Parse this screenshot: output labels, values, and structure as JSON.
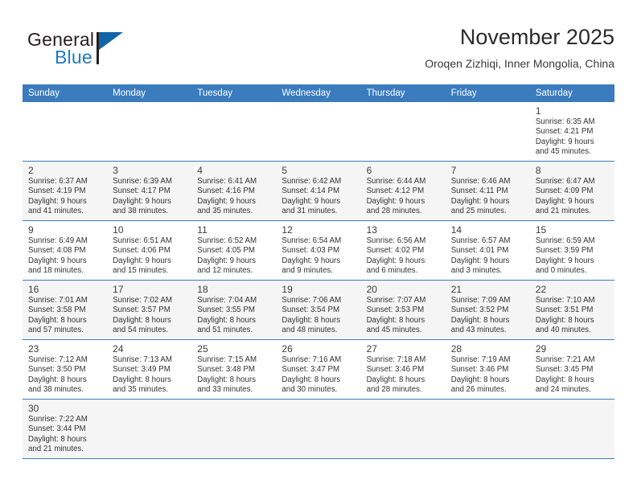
{
  "brand": {
    "name_part1": "General",
    "name_part2": "Blue",
    "logo_icon": "triangle-flag-icon",
    "accent_color": "#1164a8"
  },
  "header": {
    "title": "November 2025",
    "subtitle": "Oroqen Zizhiqi, Inner Mongolia, China"
  },
  "theme": {
    "header_bar_color": "#3a7cbe",
    "shaded_row_color": "#f5f5f5",
    "grid_line_color": "#3a7cbe"
  },
  "weekdays": [
    "Sunday",
    "Monday",
    "Tuesday",
    "Wednesday",
    "Thursday",
    "Friday",
    "Saturday"
  ],
  "weeks": [
    {
      "shaded": false,
      "days": [
        {
          "number": "",
          "sunrise": "",
          "sunset": "",
          "daylight_line1": "",
          "daylight_line2": "",
          "empty": true
        },
        {
          "number": "",
          "sunrise": "",
          "sunset": "",
          "daylight_line1": "",
          "daylight_line2": "",
          "empty": true
        },
        {
          "number": "",
          "sunrise": "",
          "sunset": "",
          "daylight_line1": "",
          "daylight_line2": "",
          "empty": true
        },
        {
          "number": "",
          "sunrise": "",
          "sunset": "",
          "daylight_line1": "",
          "daylight_line2": "",
          "empty": true
        },
        {
          "number": "",
          "sunrise": "",
          "sunset": "",
          "daylight_line1": "",
          "daylight_line2": "",
          "empty": true
        },
        {
          "number": "",
          "sunrise": "",
          "sunset": "",
          "daylight_line1": "",
          "daylight_line2": "",
          "empty": true
        },
        {
          "number": "1",
          "sunrise": "Sunrise: 6:35 AM",
          "sunset": "Sunset: 4:21 PM",
          "daylight_line1": "Daylight: 9 hours",
          "daylight_line2": "and 45 minutes.",
          "empty": false
        }
      ]
    },
    {
      "shaded": true,
      "days": [
        {
          "number": "2",
          "sunrise": "Sunrise: 6:37 AM",
          "sunset": "Sunset: 4:19 PM",
          "daylight_line1": "Daylight: 9 hours",
          "daylight_line2": "and 41 minutes.",
          "empty": false
        },
        {
          "number": "3",
          "sunrise": "Sunrise: 6:39 AM",
          "sunset": "Sunset: 4:17 PM",
          "daylight_line1": "Daylight: 9 hours",
          "daylight_line2": "and 38 minutes.",
          "empty": false
        },
        {
          "number": "4",
          "sunrise": "Sunrise: 6:41 AM",
          "sunset": "Sunset: 4:16 PM",
          "daylight_line1": "Daylight: 9 hours",
          "daylight_line2": "and 35 minutes.",
          "empty": false
        },
        {
          "number": "5",
          "sunrise": "Sunrise: 6:42 AM",
          "sunset": "Sunset: 4:14 PM",
          "daylight_line1": "Daylight: 9 hours",
          "daylight_line2": "and 31 minutes.",
          "empty": false
        },
        {
          "number": "6",
          "sunrise": "Sunrise: 6:44 AM",
          "sunset": "Sunset: 4:12 PM",
          "daylight_line1": "Daylight: 9 hours",
          "daylight_line2": "and 28 minutes.",
          "empty": false
        },
        {
          "number": "7",
          "sunrise": "Sunrise: 6:46 AM",
          "sunset": "Sunset: 4:11 PM",
          "daylight_line1": "Daylight: 9 hours",
          "daylight_line2": "and 25 minutes.",
          "empty": false
        },
        {
          "number": "8",
          "sunrise": "Sunrise: 6:47 AM",
          "sunset": "Sunset: 4:09 PM",
          "daylight_line1": "Daylight: 9 hours",
          "daylight_line2": "and 21 minutes.",
          "empty": false
        }
      ]
    },
    {
      "shaded": false,
      "days": [
        {
          "number": "9",
          "sunrise": "Sunrise: 6:49 AM",
          "sunset": "Sunset: 4:08 PM",
          "daylight_line1": "Daylight: 9 hours",
          "daylight_line2": "and 18 minutes.",
          "empty": false
        },
        {
          "number": "10",
          "sunrise": "Sunrise: 6:51 AM",
          "sunset": "Sunset: 4:06 PM",
          "daylight_line1": "Daylight: 9 hours",
          "daylight_line2": "and 15 minutes.",
          "empty": false
        },
        {
          "number": "11",
          "sunrise": "Sunrise: 6:52 AM",
          "sunset": "Sunset: 4:05 PM",
          "daylight_line1": "Daylight: 9 hours",
          "daylight_line2": "and 12 minutes.",
          "empty": false
        },
        {
          "number": "12",
          "sunrise": "Sunrise: 6:54 AM",
          "sunset": "Sunset: 4:03 PM",
          "daylight_line1": "Daylight: 9 hours",
          "daylight_line2": "and 9 minutes.",
          "empty": false
        },
        {
          "number": "13",
          "sunrise": "Sunrise: 6:56 AM",
          "sunset": "Sunset: 4:02 PM",
          "daylight_line1": "Daylight: 9 hours",
          "daylight_line2": "and 6 minutes.",
          "empty": false
        },
        {
          "number": "14",
          "sunrise": "Sunrise: 6:57 AM",
          "sunset": "Sunset: 4:01 PM",
          "daylight_line1": "Daylight: 9 hours",
          "daylight_line2": "and 3 minutes.",
          "empty": false
        },
        {
          "number": "15",
          "sunrise": "Sunrise: 6:59 AM",
          "sunset": "Sunset: 3:59 PM",
          "daylight_line1": "Daylight: 9 hours",
          "daylight_line2": "and 0 minutes.",
          "empty": false
        }
      ]
    },
    {
      "shaded": true,
      "days": [
        {
          "number": "16",
          "sunrise": "Sunrise: 7:01 AM",
          "sunset": "Sunset: 3:58 PM",
          "daylight_line1": "Daylight: 8 hours",
          "daylight_line2": "and 57 minutes.",
          "empty": false
        },
        {
          "number": "17",
          "sunrise": "Sunrise: 7:02 AM",
          "sunset": "Sunset: 3:57 PM",
          "daylight_line1": "Daylight: 8 hours",
          "daylight_line2": "and 54 minutes.",
          "empty": false
        },
        {
          "number": "18",
          "sunrise": "Sunrise: 7:04 AM",
          "sunset": "Sunset: 3:55 PM",
          "daylight_line1": "Daylight: 8 hours",
          "daylight_line2": "and 51 minutes.",
          "empty": false
        },
        {
          "number": "19",
          "sunrise": "Sunrise: 7:06 AM",
          "sunset": "Sunset: 3:54 PM",
          "daylight_line1": "Daylight: 8 hours",
          "daylight_line2": "and 48 minutes.",
          "empty": false
        },
        {
          "number": "20",
          "sunrise": "Sunrise: 7:07 AM",
          "sunset": "Sunset: 3:53 PM",
          "daylight_line1": "Daylight: 8 hours",
          "daylight_line2": "and 45 minutes.",
          "empty": false
        },
        {
          "number": "21",
          "sunrise": "Sunrise: 7:09 AM",
          "sunset": "Sunset: 3:52 PM",
          "daylight_line1": "Daylight: 8 hours",
          "daylight_line2": "and 43 minutes.",
          "empty": false
        },
        {
          "number": "22",
          "sunrise": "Sunrise: 7:10 AM",
          "sunset": "Sunset: 3:51 PM",
          "daylight_line1": "Daylight: 8 hours",
          "daylight_line2": "and 40 minutes.",
          "empty": false
        }
      ]
    },
    {
      "shaded": false,
      "days": [
        {
          "number": "23",
          "sunrise": "Sunrise: 7:12 AM",
          "sunset": "Sunset: 3:50 PM",
          "daylight_line1": "Daylight: 8 hours",
          "daylight_line2": "and 38 minutes.",
          "empty": false
        },
        {
          "number": "24",
          "sunrise": "Sunrise: 7:13 AM",
          "sunset": "Sunset: 3:49 PM",
          "daylight_line1": "Daylight: 8 hours",
          "daylight_line2": "and 35 minutes.",
          "empty": false
        },
        {
          "number": "25",
          "sunrise": "Sunrise: 7:15 AM",
          "sunset": "Sunset: 3:48 PM",
          "daylight_line1": "Daylight: 8 hours",
          "daylight_line2": "and 33 minutes.",
          "empty": false
        },
        {
          "number": "26",
          "sunrise": "Sunrise: 7:16 AM",
          "sunset": "Sunset: 3:47 PM",
          "daylight_line1": "Daylight: 8 hours",
          "daylight_line2": "and 30 minutes.",
          "empty": false
        },
        {
          "number": "27",
          "sunrise": "Sunrise: 7:18 AM",
          "sunset": "Sunset: 3:46 PM",
          "daylight_line1": "Daylight: 8 hours",
          "daylight_line2": "and 28 minutes.",
          "empty": false
        },
        {
          "number": "28",
          "sunrise": "Sunrise: 7:19 AM",
          "sunset": "Sunset: 3:46 PM",
          "daylight_line1": "Daylight: 8 hours",
          "daylight_line2": "and 26 minutes.",
          "empty": false
        },
        {
          "number": "29",
          "sunrise": "Sunrise: 7:21 AM",
          "sunset": "Sunset: 3:45 PM",
          "daylight_line1": "Daylight: 8 hours",
          "daylight_line2": "and 24 minutes.",
          "empty": false
        }
      ]
    },
    {
      "shaded": true,
      "days": [
        {
          "number": "30",
          "sunrise": "Sunrise: 7:22 AM",
          "sunset": "Sunset: 3:44 PM",
          "daylight_line1": "Daylight: 8 hours",
          "daylight_line2": "and 21 minutes.",
          "empty": false
        },
        {
          "number": "",
          "sunrise": "",
          "sunset": "",
          "daylight_line1": "",
          "daylight_line2": "",
          "empty": true
        },
        {
          "number": "",
          "sunrise": "",
          "sunset": "",
          "daylight_line1": "",
          "daylight_line2": "",
          "empty": true
        },
        {
          "number": "",
          "sunrise": "",
          "sunset": "",
          "daylight_line1": "",
          "daylight_line2": "",
          "empty": true
        },
        {
          "number": "",
          "sunrise": "",
          "sunset": "",
          "daylight_line1": "",
          "daylight_line2": "",
          "empty": true
        },
        {
          "number": "",
          "sunrise": "",
          "sunset": "",
          "daylight_line1": "",
          "daylight_line2": "",
          "empty": true
        },
        {
          "number": "",
          "sunrise": "",
          "sunset": "",
          "daylight_line1": "",
          "daylight_line2": "",
          "empty": true
        }
      ]
    }
  ]
}
